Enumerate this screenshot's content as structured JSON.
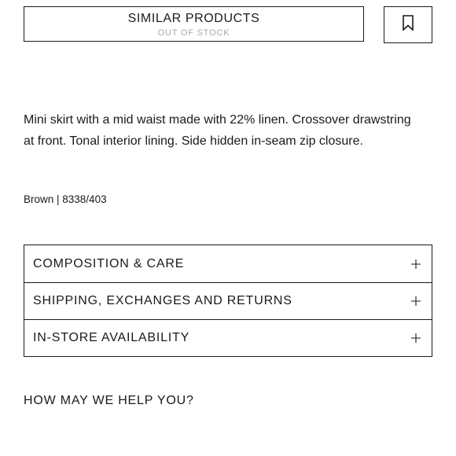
{
  "actions": {
    "similar_products_label": "SIMILAR PRODUCTS",
    "stock_status": "OUT OF STOCK",
    "bookmark_icon": "bookmark-icon"
  },
  "product": {
    "description": "Mini skirt with a mid waist made with 22% linen. Crossover drawstring at front. Tonal interior lining. Side hidden in-seam zip closure.",
    "color_reference": "Brown | 8338/403"
  },
  "accordion": {
    "icon": "plus-icon",
    "items": [
      {
        "label": "COMPOSITION & CARE"
      },
      {
        "label": "SHIPPING, EXCHANGES AND RETURNS"
      },
      {
        "label": "IN-STORE AVAILABILITY"
      }
    ]
  },
  "help": {
    "heading": "HOW MAY WE HELP YOU?"
  }
}
